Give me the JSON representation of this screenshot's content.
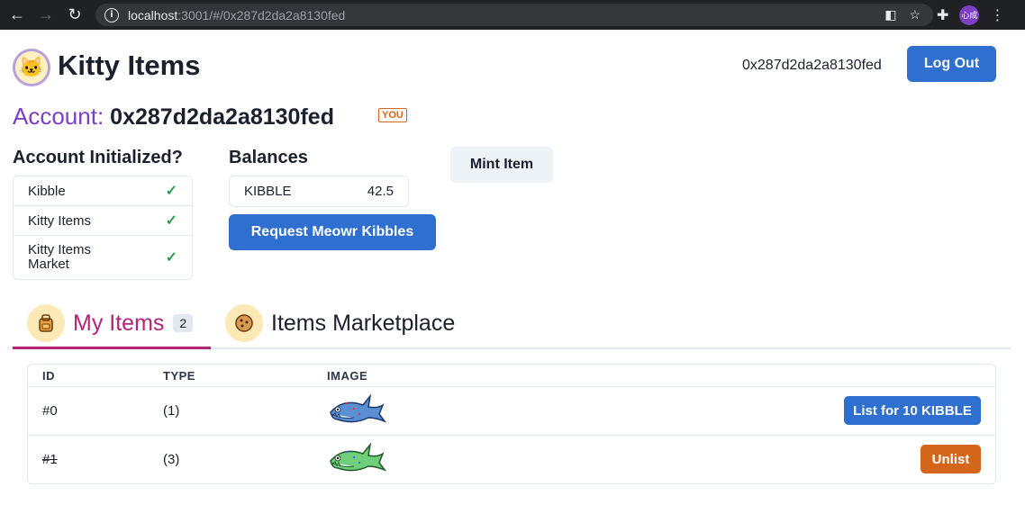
{
  "browser": {
    "url_host": "localhost",
    "url_rest": ":3001/#/0x287d2da2a8130fed",
    "profile_label": "心成",
    "icons": [
      "back-icon",
      "forward-icon",
      "reload-icon",
      "info-icon",
      "translate-icon",
      "star-icon",
      "puzzle-icon",
      "menu-icon"
    ]
  },
  "header": {
    "title": "Kitty Items",
    "address": "0x287d2da2a8130fed",
    "logout_label": "Log Out",
    "logo_icon": "kitty-logo-icon"
  },
  "account": {
    "label": "Account:",
    "address": "0x287d2da2a8130fed",
    "badge": "YOU"
  },
  "initialized": {
    "heading": "Account Initialized?",
    "rows": [
      {
        "label": "Kibble",
        "status": "check-icon"
      },
      {
        "label": "Kitty Items",
        "status": "check-icon"
      },
      {
        "label": "Kitty Items Market",
        "status": "check-icon"
      }
    ]
  },
  "balances": {
    "heading": "Balances",
    "token": "KIBBLE",
    "amount": "42.5",
    "request_label": "Request Meowr Kibbles"
  },
  "mint": {
    "label": "Mint Item"
  },
  "tabs": [
    {
      "label": "My Items",
      "count": "2",
      "icon": "backpack-icon",
      "active": true
    },
    {
      "label": "Items Marketplace",
      "icon": "cookie-icon",
      "active": false
    }
  ],
  "table": {
    "headers": [
      "ID",
      "TYPE",
      "IMAGE"
    ],
    "rows": [
      {
        "id": "#0",
        "type": "(1)",
        "image": "blue-shark-item",
        "action": "List for 10 KIBBLE"
      },
      {
        "id": "#1",
        "type": "(3)",
        "image": "green-shark-item",
        "action": "Unlist"
      }
    ]
  },
  "colors": {
    "primary_blue": "#2f6fcf",
    "accent_purple": "#7b3fc4",
    "tab_active": "#b0257a",
    "unlist_orange": "#d4661c",
    "check_green": "#2f9e5a"
  }
}
